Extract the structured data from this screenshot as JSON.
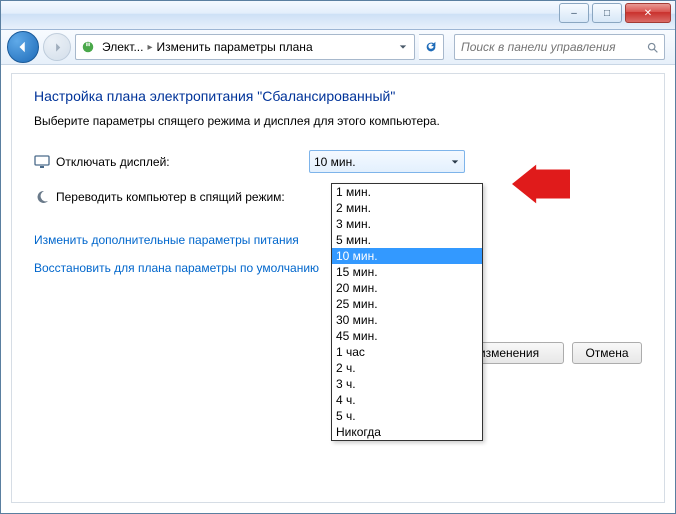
{
  "titlebar": {
    "minimize": "–",
    "maximize": "□",
    "close": "✕"
  },
  "nav": {
    "crumb1": "Элект...",
    "crumb2": "Изменить параметры плана",
    "search_placeholder": "Поиск в панели управления"
  },
  "page": {
    "heading": "Настройка плана электропитания \"Сбалансированный\"",
    "subtitle": "Выберите параметры спящего режима и дисплея для этого компьютера.",
    "row1_label": "Отключать дисплей:",
    "row1_value": "10 мин.",
    "row2_label": "Переводить компьютер в спящий режим:",
    "link1": "Изменить дополнительные параметры питания",
    "link2": "Восстановить для плана параметры по умолчанию",
    "btn_save": "изменения",
    "btn_cancel": "Отмена"
  },
  "dropdown": {
    "options": [
      "1 мин.",
      "2 мин.",
      "3 мин.",
      "5 мин.",
      "10 мин.",
      "15 мин.",
      "20 мин.",
      "25 мин.",
      "30 мин.",
      "45 мин.",
      "1 час",
      "2 ч.",
      "3 ч.",
      "4 ч.",
      "5 ч.",
      "Никогда"
    ],
    "selected": "10 мин."
  }
}
